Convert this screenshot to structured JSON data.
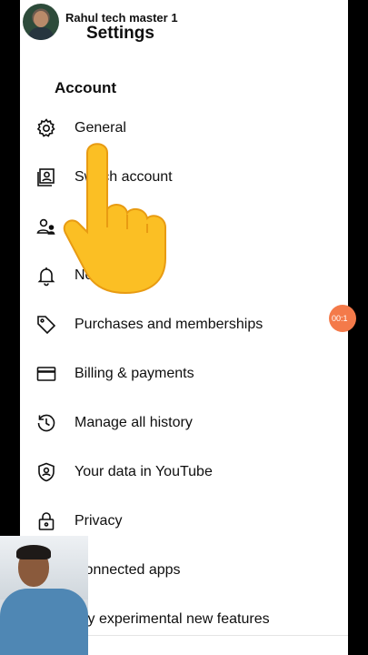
{
  "header": {
    "channel_name": "Rahul tech master 1",
    "title": "Settings"
  },
  "section": {
    "title": "Account"
  },
  "menu": [
    {
      "icon": "gear-icon",
      "label": "General"
    },
    {
      "icon": "switch-account-icon",
      "label": "Switch account"
    },
    {
      "icon": "family-center-icon",
      "label": ""
    },
    {
      "icon": "bell-icon",
      "label": "Notifications"
    },
    {
      "icon": "tag-icon",
      "label": "Purchases and memberships"
    },
    {
      "icon": "credit-card-icon",
      "label": "Billing & payments"
    },
    {
      "icon": "history-icon",
      "label": "Manage all history"
    },
    {
      "icon": "shield-person-icon",
      "label": "Your data in YouTube"
    },
    {
      "icon": "lock-icon",
      "label": "Privacy"
    },
    {
      "icon": "link-icon",
      "label": "Connected apps"
    },
    {
      "icon": "flask-icon",
      "label": "Try experimental new features"
    }
  ],
  "overlay": {
    "timer": "00:1"
  },
  "colors": {
    "background": "#ffffff",
    "text": "#0f0f0f",
    "timer_badge": "#f47a4a",
    "cursor": "#fbbf24"
  }
}
